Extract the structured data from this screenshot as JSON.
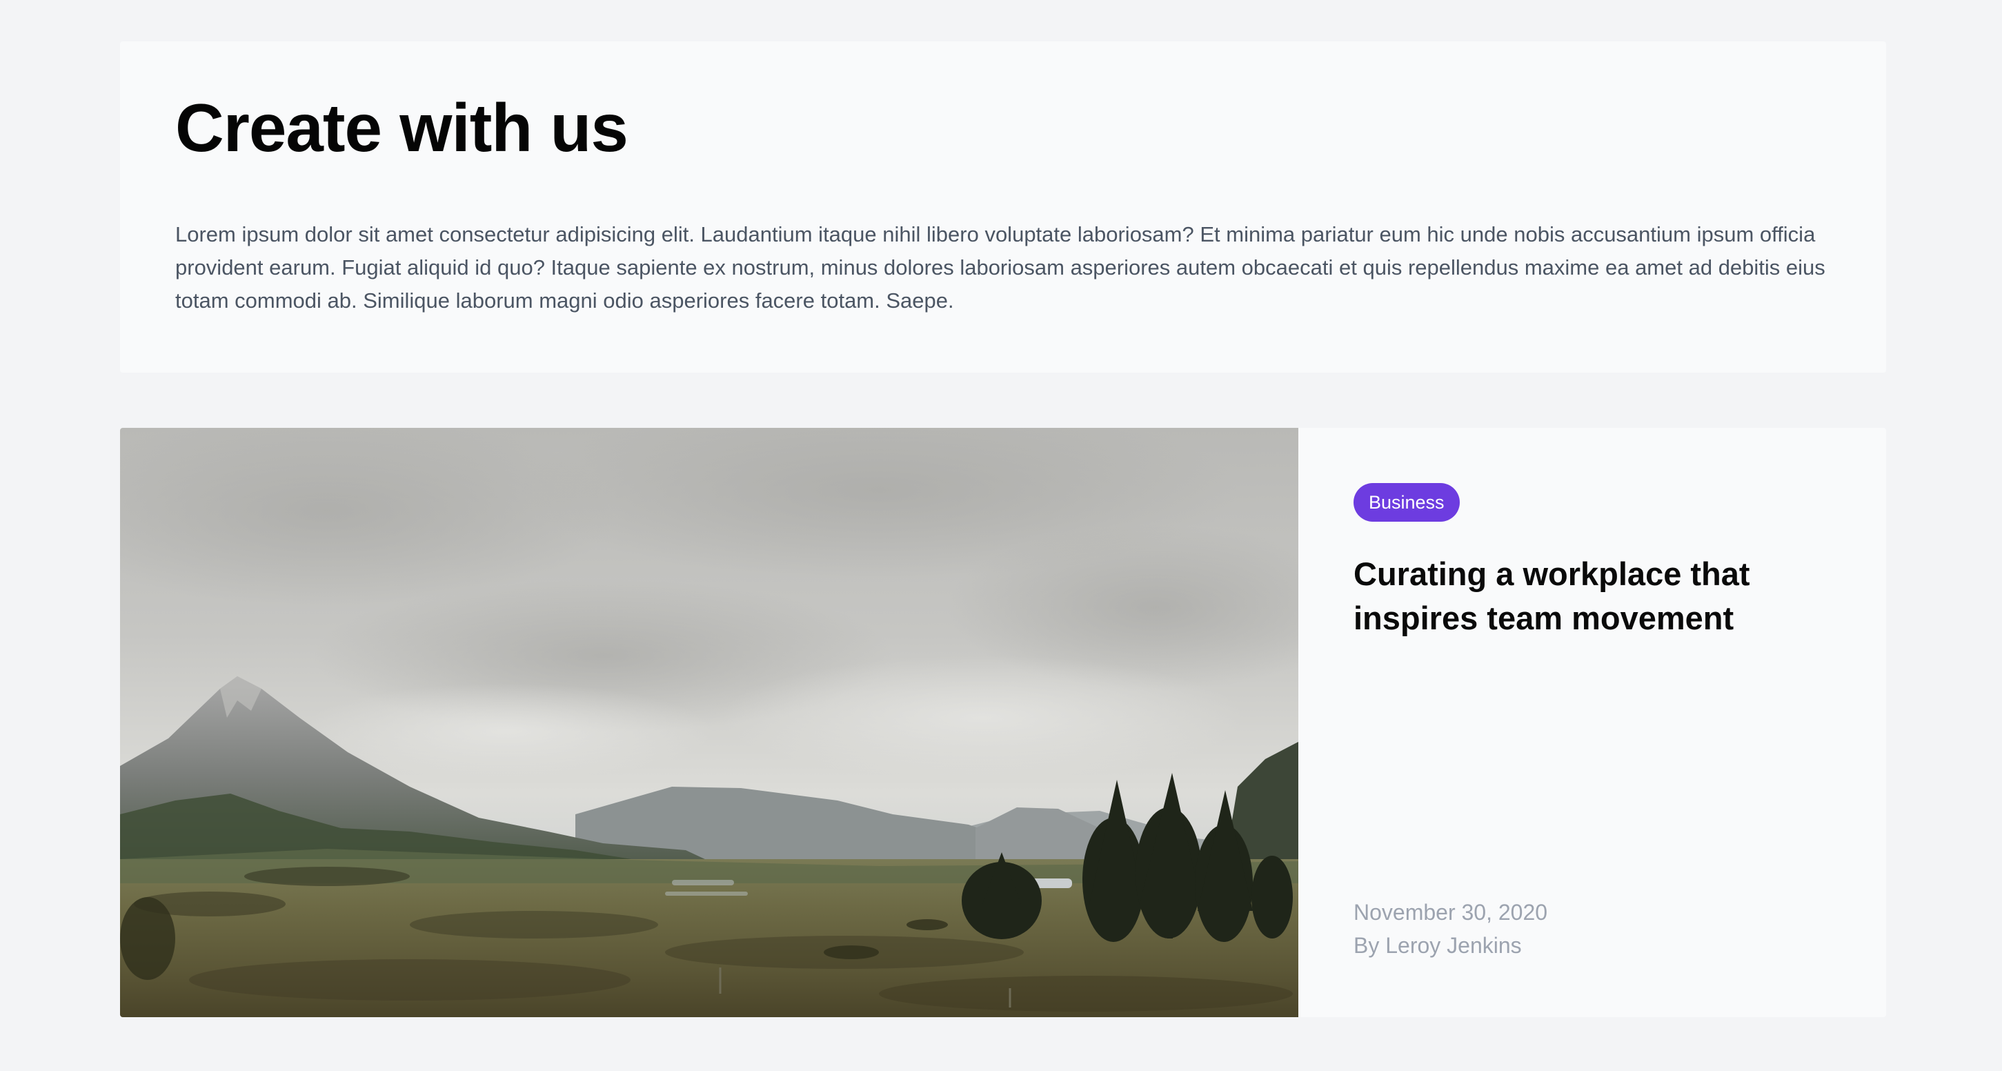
{
  "intro": {
    "title": "Create with us",
    "body": "Lorem ipsum dolor sit amet consectetur adipisicing elit. Laudantium itaque nihil libero voluptate laboriosam? Et minima pariatur eum hic unde nobis accusantium ipsum officia provident earum. Fugiat aliquid id quo? Itaque sapiente ex nostrum, minus dolores laboriosam asperiores autem obcaecati et quis repellendus maxime ea amet ad debitis eius totam commodi ab. Similique laborum magni odio asperiores facere totam. Saepe."
  },
  "featured_post": {
    "image_subject": "mountain-valley-landscape",
    "category": "Business",
    "title": "Curating a workplace that inspires team movement",
    "date": "November 30, 2020",
    "author": "By Leroy Jenkins"
  },
  "colors": {
    "page_background": "#f3f4f6",
    "card_background": "#f9fafb",
    "badge_background": "#6d3ce0",
    "heading_text": "#050505",
    "body_text": "#4b5563",
    "meta_text": "#9ca3af"
  }
}
